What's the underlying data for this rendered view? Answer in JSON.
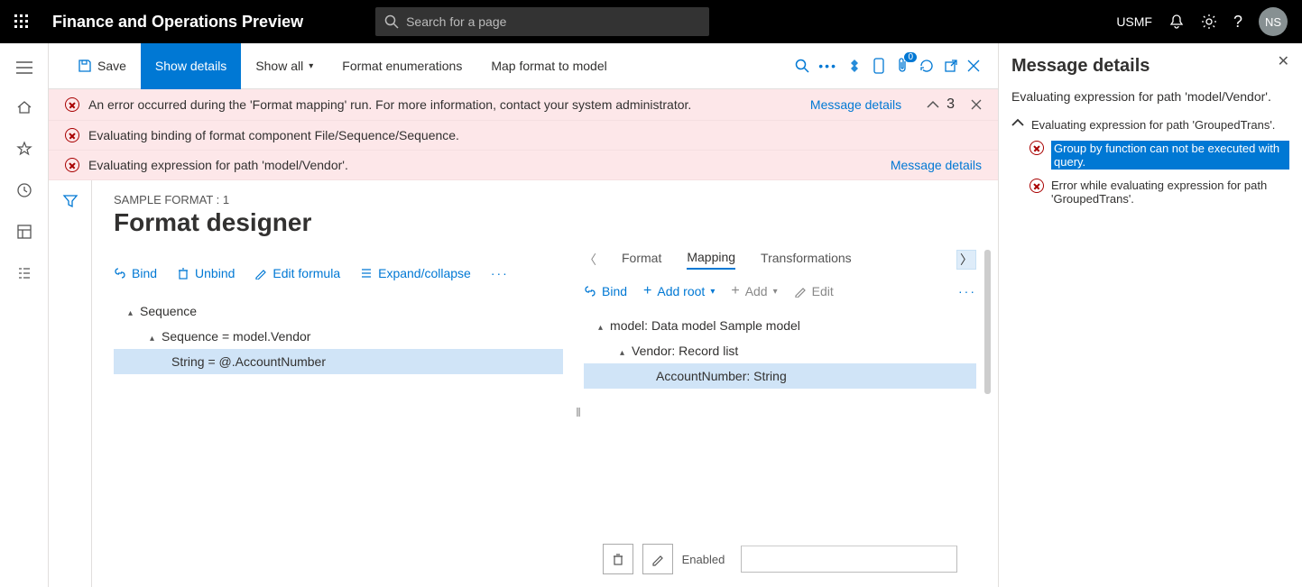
{
  "topbar": {
    "title": "Finance and Operations Preview",
    "search_placeholder": "Search for a page",
    "company": "USMF",
    "avatar": "NS"
  },
  "cmdbar": {
    "save": "Save",
    "show_details": "Show details",
    "show_all": "Show all",
    "format_enum": "Format enumerations",
    "map_format": "Map format to model",
    "badge_count": "0"
  },
  "errors": {
    "rows": [
      "An error occurred during the 'Format mapping' run. For more information, contact your system administrator.",
      "Evaluating binding of format component File/Sequence/Sequence.",
      "Evaluating expression for path 'model/Vendor'."
    ],
    "message_details": "Message details",
    "count": "3"
  },
  "designer": {
    "crumb": "SAMPLE FORMAT : 1",
    "title": "Format designer",
    "toolbar": {
      "bind": "Bind",
      "unbind": "Unbind",
      "edit": "Edit formula",
      "expand": "Expand/collapse"
    },
    "tree": {
      "n0": "Sequence",
      "n1": "Sequence = model.Vendor",
      "n2": "String = @.AccountNumber"
    },
    "tabs": {
      "format": "Format",
      "mapping": "Mapping",
      "transformations": "Transformations"
    },
    "map_toolbar": {
      "bind": "Bind",
      "add_root": "Add root",
      "add": "Add",
      "edit": "Edit"
    },
    "model_tree": {
      "n0": "model: Data model Sample model",
      "n1": "Vendor: Record list",
      "n2": "AccountNumber: String"
    },
    "enabled_label": "Enabled"
  },
  "msgpanel": {
    "title": "Message details",
    "line1": "Evaluating expression for path 'model/Vendor'.",
    "line2": "Evaluating expression for path 'GroupedTrans'.",
    "err1": "Group by function can not be executed with query.",
    "err2": "Error while evaluating expression for path 'GroupedTrans'."
  }
}
